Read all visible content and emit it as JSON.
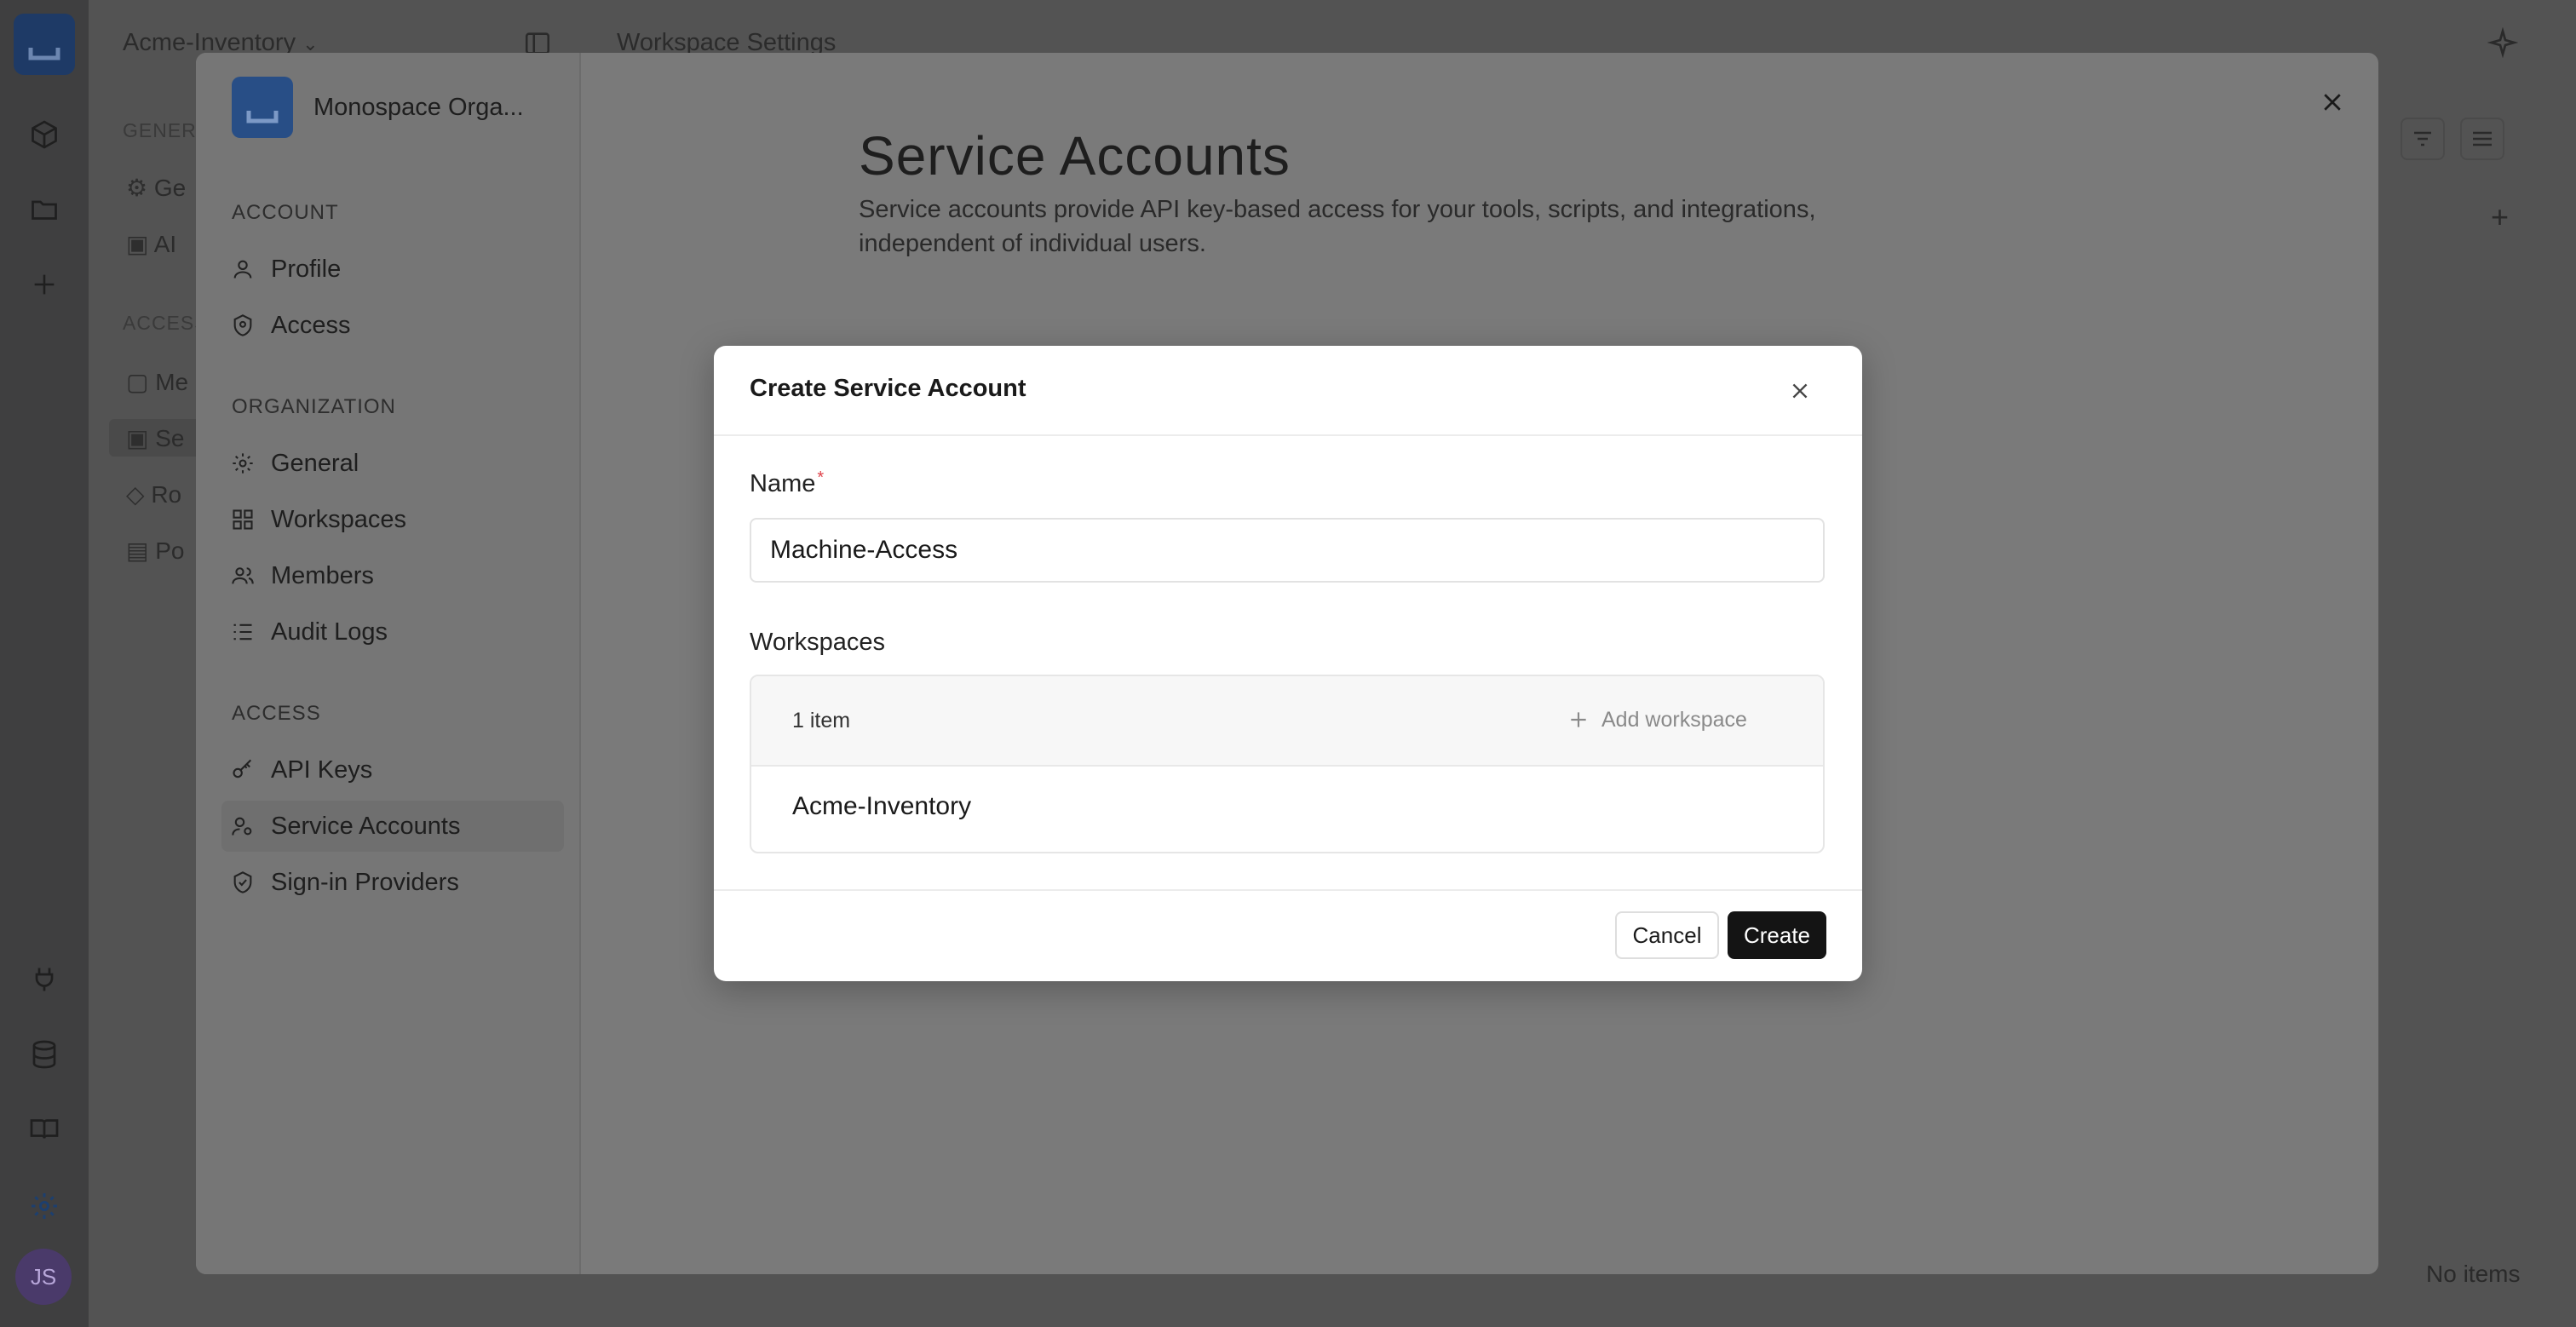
{
  "topbar": {
    "workspace_name": "Acme-Inventory",
    "page_title": "Workspace Settings"
  },
  "bg_sidebar": {
    "section_general": "GENERA",
    "section_access": "ACCESS",
    "items": [
      "Ge",
      "AI",
      "Me",
      "Se",
      "Ro",
      "Po"
    ]
  },
  "bg_footer": {
    "status": "No items"
  },
  "rail": {
    "avatar_initials": "JS"
  },
  "settings": {
    "org_name": "Monospace Orga...",
    "sections": [
      {
        "label": "ACCOUNT",
        "items": [
          {
            "label": "Profile",
            "icon": "user-icon"
          },
          {
            "label": "Access",
            "icon": "shield-icon"
          }
        ]
      },
      {
        "label": "ORGANIZATION",
        "items": [
          {
            "label": "General",
            "icon": "gear-icon"
          },
          {
            "label": "Workspaces",
            "icon": "grid-icon"
          },
          {
            "label": "Members",
            "icon": "users-icon"
          },
          {
            "label": "Audit Logs",
            "icon": "list-icon"
          }
        ]
      },
      {
        "label": "ACCESS",
        "items": [
          {
            "label": "API Keys",
            "icon": "key-icon"
          },
          {
            "label": "Service Accounts",
            "icon": "user-gear-icon",
            "selected": true
          },
          {
            "label": "Sign-in Providers",
            "icon": "shield-check-icon"
          }
        ]
      }
    ],
    "main": {
      "title": "Service Accounts",
      "description": "Service accounts provide API key-based access for your tools, scripts, and integrations, independent of individual users."
    }
  },
  "dialog": {
    "title": "Create Service Account",
    "name_label": "Name",
    "required_mark": "*",
    "name_value": "Machine-Access",
    "workspaces_label": "Workspaces",
    "workspace_count": "1 item",
    "add_workspace_label": "Add workspace",
    "workspaces": [
      "Acme-Inventory"
    ],
    "cancel_label": "Cancel",
    "create_label": "Create"
  },
  "colors": {
    "overlay": "#535353",
    "primary_button": "#141414",
    "required": "#e0424a",
    "brand": "#284e86"
  }
}
